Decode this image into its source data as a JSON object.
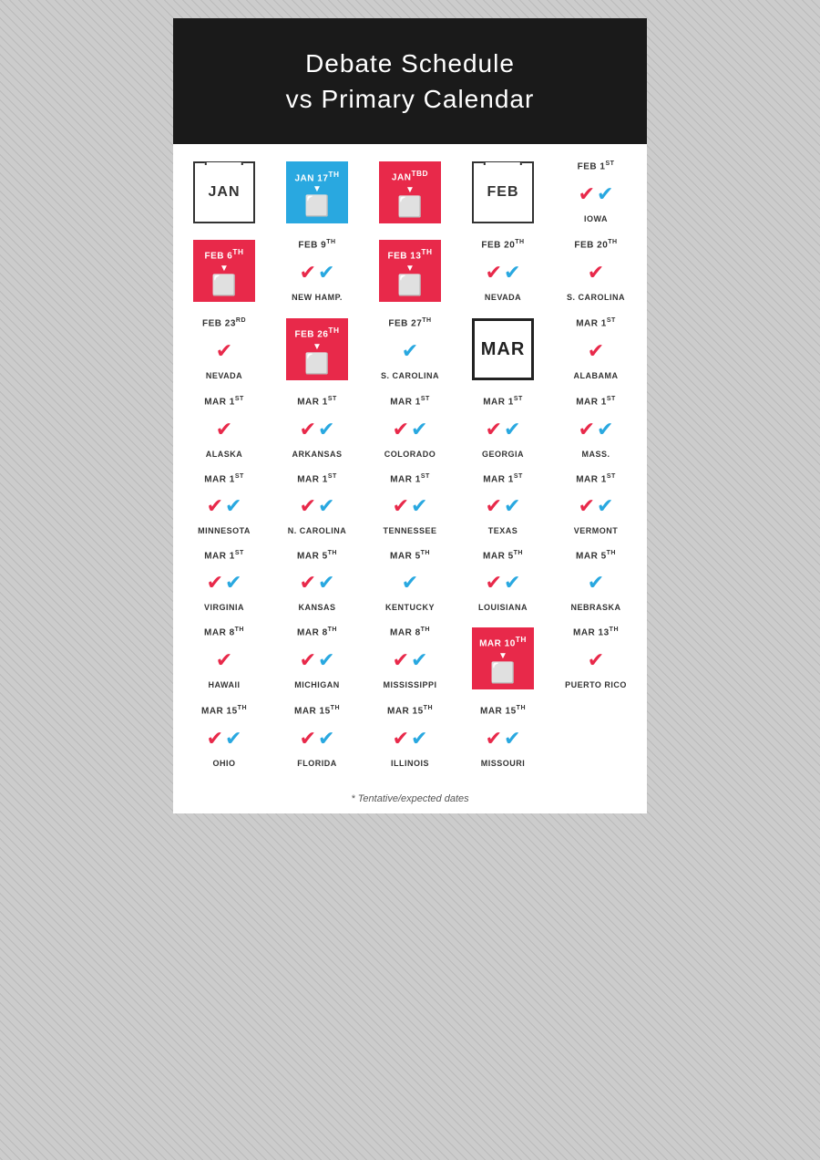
{
  "header": {
    "line1": "Debate Schedule",
    "line2": "vs  Primary Calendar"
  },
  "rows": [
    {
      "cells": [
        {
          "type": "cal-white",
          "month": "JAN"
        },
        {
          "type": "cal-blue",
          "date": "JAN 17",
          "sup": "TH",
          "hasTV": true
        },
        {
          "type": "cal-red",
          "date": "JAN",
          "sup": "TBD",
          "hasTV": true
        },
        {
          "type": "cal-white",
          "month": "FEB"
        },
        {
          "type": "check",
          "date": "FEB 1",
          "sup": "ST",
          "checks": [
            {
              "color": "red"
            },
            {
              "color": "blue"
            }
          ],
          "state": "IOWA"
        }
      ]
    },
    {
      "cells": [
        {
          "type": "cal-red",
          "date": "FEB 6",
          "sup": "TH",
          "hasTV": true
        },
        {
          "type": "check",
          "date": "FEB 9",
          "sup": "TH",
          "checks": [
            {
              "color": "red"
            },
            {
              "color": "blue"
            }
          ],
          "state": "NEW HAMP."
        },
        {
          "type": "cal-red",
          "date": "FEB 13",
          "sup": "TH",
          "hasTV": true
        },
        {
          "type": "check",
          "date": "FEB 20",
          "sup": "TH",
          "checks": [
            {
              "color": "red"
            },
            {
              "color": "blue"
            }
          ],
          "state": "NEVADA"
        },
        {
          "type": "check",
          "date": "FEB 20",
          "sup": "TH",
          "checks": [
            {
              "color": "red"
            }
          ],
          "state": "S. CAROLINA"
        }
      ]
    },
    {
      "cells": [
        {
          "type": "check",
          "date": "FEB 23",
          "sup": "RD",
          "checks": [
            {
              "color": "red"
            }
          ],
          "state": "NEVADA"
        },
        {
          "type": "cal-red",
          "date": "FEB 26",
          "sup": "TH",
          "hasTV": true
        },
        {
          "type": "check",
          "date": "FEB 27",
          "sup": "TH",
          "checks": [
            {
              "color": "blue"
            }
          ],
          "state": "S. CAROLINA"
        },
        {
          "type": "cal-black",
          "month": "MAR"
        },
        {
          "type": "check",
          "date": "MAR 1",
          "sup": "ST",
          "checks": [
            {
              "color": "red"
            }
          ],
          "state": "ALABAMA"
        }
      ]
    },
    {
      "cells": [
        {
          "type": "check",
          "date": "MAR 1",
          "sup": "ST",
          "checks": [
            {
              "color": "red"
            }
          ],
          "state": "ALASKA"
        },
        {
          "type": "check",
          "date": "MAR 1",
          "sup": "ST",
          "checks": [
            {
              "color": "red"
            },
            {
              "color": "blue"
            }
          ],
          "state": "ARKANSAS"
        },
        {
          "type": "check",
          "date": "MAR 1",
          "sup": "ST",
          "checks": [
            {
              "color": "red"
            },
            {
              "color": "blue"
            }
          ],
          "state": "COLORADO"
        },
        {
          "type": "check",
          "date": "MAR 1",
          "sup": "ST",
          "checks": [
            {
              "color": "red"
            },
            {
              "color": "blue"
            }
          ],
          "state": "GEORGIA"
        },
        {
          "type": "check",
          "date": "MAR 1",
          "sup": "ST",
          "checks": [
            {
              "color": "red"
            },
            {
              "color": "blue"
            }
          ],
          "state": "MASS."
        }
      ]
    },
    {
      "cells": [
        {
          "type": "check",
          "date": "MAR 1",
          "sup": "ST",
          "checks": [
            {
              "color": "red"
            },
            {
              "color": "blue"
            }
          ],
          "state": "MINNESOTA"
        },
        {
          "type": "check",
          "date": "MAR 1",
          "sup": "ST",
          "checks": [
            {
              "color": "red"
            },
            {
              "color": "blue"
            }
          ],
          "state": "N. CAROLINA"
        },
        {
          "type": "check",
          "date": "MAR 1",
          "sup": "ST",
          "checks": [
            {
              "color": "red"
            },
            {
              "color": "blue"
            }
          ],
          "state": "TENNESSEE"
        },
        {
          "type": "check",
          "date": "MAR 1",
          "sup": "ST",
          "checks": [
            {
              "color": "red"
            },
            {
              "color": "blue"
            }
          ],
          "state": "TEXAS"
        },
        {
          "type": "check",
          "date": "MAR 1",
          "sup": "ST",
          "checks": [
            {
              "color": "red"
            },
            {
              "color": "blue"
            }
          ],
          "state": "VERMONT"
        }
      ]
    },
    {
      "cells": [
        {
          "type": "check",
          "date": "MAR 1",
          "sup": "ST",
          "checks": [
            {
              "color": "red"
            },
            {
              "color": "blue"
            }
          ],
          "state": "VIRGINIA"
        },
        {
          "type": "check",
          "date": "MAR 5",
          "sup": "TH",
          "checks": [
            {
              "color": "red"
            },
            {
              "color": "blue"
            }
          ],
          "state": "KANSAS"
        },
        {
          "type": "check",
          "date": "MAR 5",
          "sup": "TH",
          "checks": [
            {
              "color": "blue"
            }
          ],
          "state": "KENTUCKY"
        },
        {
          "type": "check",
          "date": "MAR 5",
          "sup": "TH",
          "checks": [
            {
              "color": "red"
            },
            {
              "color": "blue"
            }
          ],
          "state": "LOUISIANA"
        },
        {
          "type": "check",
          "date": "MAR 5",
          "sup": "TH",
          "checks": [
            {
              "color": "blue"
            }
          ],
          "state": "NEBRASKA"
        }
      ]
    },
    {
      "cells": [
        {
          "type": "check",
          "date": "MAR 8",
          "sup": "TH",
          "checks": [
            {
              "color": "red"
            }
          ],
          "state": "HAWAII"
        },
        {
          "type": "check",
          "date": "MAR 8",
          "sup": "TH",
          "checks": [
            {
              "color": "red"
            },
            {
              "color": "blue"
            }
          ],
          "state": "MICHIGAN"
        },
        {
          "type": "check",
          "date": "MAR 8",
          "sup": "TH",
          "checks": [
            {
              "color": "red"
            },
            {
              "color": "blue"
            }
          ],
          "state": "MISSISSIPPI"
        },
        {
          "type": "cal-red",
          "date": "MAR 10",
          "sup": "TH",
          "hasTV": true
        },
        {
          "type": "check",
          "date": "MAR 13",
          "sup": "TH",
          "checks": [
            {
              "color": "red"
            }
          ],
          "state": "PUERTO RICO"
        }
      ]
    },
    {
      "cells": [
        {
          "type": "check",
          "date": "MAR 15",
          "sup": "TH",
          "checks": [
            {
              "color": "red"
            },
            {
              "color": "blue"
            }
          ],
          "state": "OHIO"
        },
        {
          "type": "check",
          "date": "MAR 15",
          "sup": "TH",
          "checks": [
            {
              "color": "red"
            },
            {
              "color": "blue"
            }
          ],
          "state": "FLORIDA"
        },
        {
          "type": "check",
          "date": "MAR 15",
          "sup": "TH",
          "checks": [
            {
              "color": "red"
            },
            {
              "color": "blue"
            }
          ],
          "state": "ILLINOIS"
        },
        {
          "type": "check",
          "date": "MAR 15",
          "sup": "TH",
          "checks": [
            {
              "color": "red"
            },
            {
              "color": "blue"
            }
          ],
          "state": "MISSOURI"
        },
        {
          "type": "empty"
        }
      ]
    }
  ],
  "footnote": "* Tentative/expected dates"
}
